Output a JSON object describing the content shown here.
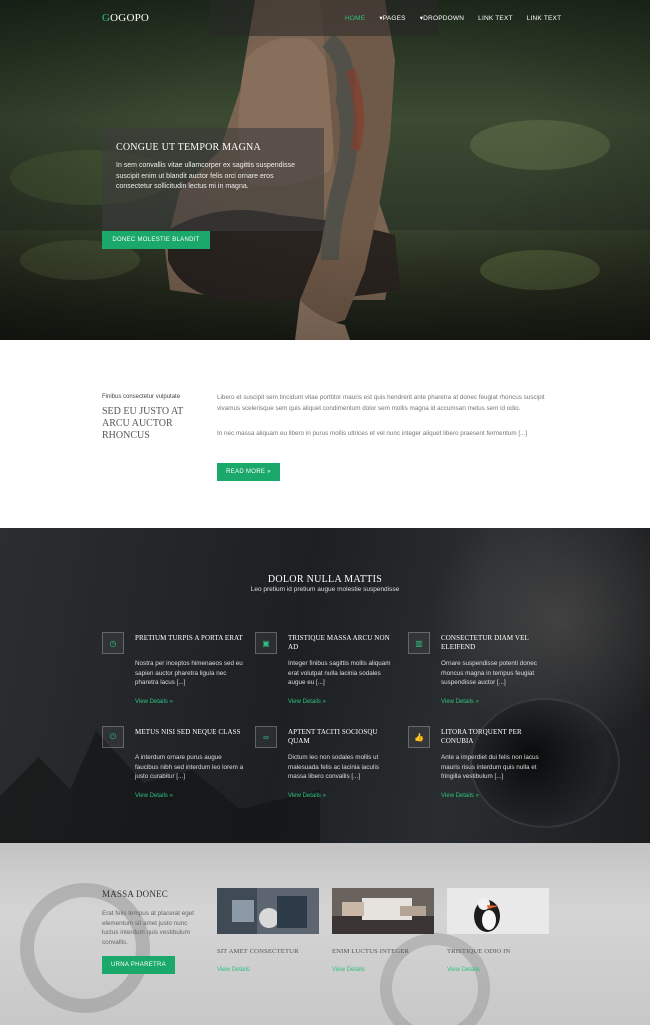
{
  "nav": {
    "logo_initial": "G",
    "logo_rest": "OGOPO",
    "items": [
      "HOME",
      "▾PAGES",
      "▾DROPDOWN",
      "LINK TEXT",
      "LINK TEXT"
    ]
  },
  "hero": {
    "title": "CONGUE UT TEMPOR MAGNA",
    "text": "In sem convallis vitae ullamcorper ex sagittis suspendisse suscipit enim ut blandit auctor felis orci ornare eros consectetur sollicitudin lectus mi in magna.",
    "button": "DONEC MOLESTIE BLANDIT"
  },
  "about": {
    "kicker": "Finibus consectetur vulputate",
    "title": "SED EU JUSTO AT ARCU AUCTOR RHONCUS",
    "p1": "Libero et suscipit sem tincidunt vitae porttitor mauris est quis hendrerit ante pharetra at donec feugiat rhoncus suscipit vivamus scelerisque sem quis aliquet condimentum dolor sem mollis magna id accumsan metus sem id odio.",
    "p2": "In nec massa aliquam eu libero in purus mollis ultrices et vel nunc integer aliquet libero praesent fermentum [...]",
    "button": "READ MORE »"
  },
  "services": {
    "title": "DOLOR NULLA MATTIS",
    "subtitle": "Leo pretium id pretium augue molestie suspendisse",
    "items": [
      {
        "icon": "clock-icon",
        "glyph": "◷",
        "title": "PRETIUM TURPIS A PORTA ERAT",
        "text": "Nostra per inceptos himenaeos sed eu sapien auctor pharetra ligula nec pharetra lacus [...]",
        "link": "View Details »"
      },
      {
        "icon": "image-icon",
        "glyph": "▣",
        "title": "TRISTIQUE MASSA ARCU NON AD",
        "text": "Integer finibus sagittis mollis aliquam erat volutpat nulla lacinia sodales augue eu [...]",
        "link": "View Details »"
      },
      {
        "icon": "bar-chart-icon",
        "glyph": "▥",
        "title": "CONSECTETUR DIAM VEL ELEIFEND",
        "text": "Ornare suspendisse potenti donec rhoncus magna in tempus feugiat suspendisse auctor [...]",
        "link": "View Details »"
      },
      {
        "icon": "power-icon",
        "glyph": "⏻",
        "title": "METUS NISI SED NEQUE CLASS",
        "text": "A interdum ornare purus augue faucibus nibh sed interdum leo lorem a justo curabitur [...]",
        "link": "View Details »"
      },
      {
        "icon": "link-icon",
        "glyph": "∞",
        "title": "APTENT TACITI SOCIOSQU QUAM",
        "text": "Dictum leo non sodales mollis ut malesuada felis ac lacinia iaculis massa libero convallis [...]",
        "link": "View Details »"
      },
      {
        "icon": "thumbs-up-icon",
        "glyph": "👍",
        "title": "LITORA TORQUENT PER CONUBIA",
        "text": "Ante a imperdiet dui felis non lacus mauris risus interdum quis nulla et fringilla vestibulum [...]",
        "link": "View Details »"
      }
    ]
  },
  "bottom": {
    "title": "MASSA DONEC",
    "text": "Erat felis tempus at placerat eget elementum sit amet justo nunc luctus interdum quis vestibulum convallis.",
    "button": "URNA PHARETRA",
    "cards": [
      {
        "title": "SIT AMET CONSECTETUR",
        "link": "View Details"
      },
      {
        "title": "ENIM LUCTUS INTEGER",
        "link": "View Details"
      },
      {
        "title": "TRISTIQUE ODIO IN",
        "link": "View Details"
      }
    ]
  },
  "colors": {
    "accent": "#1aa86b",
    "dark": "#1d2023"
  }
}
